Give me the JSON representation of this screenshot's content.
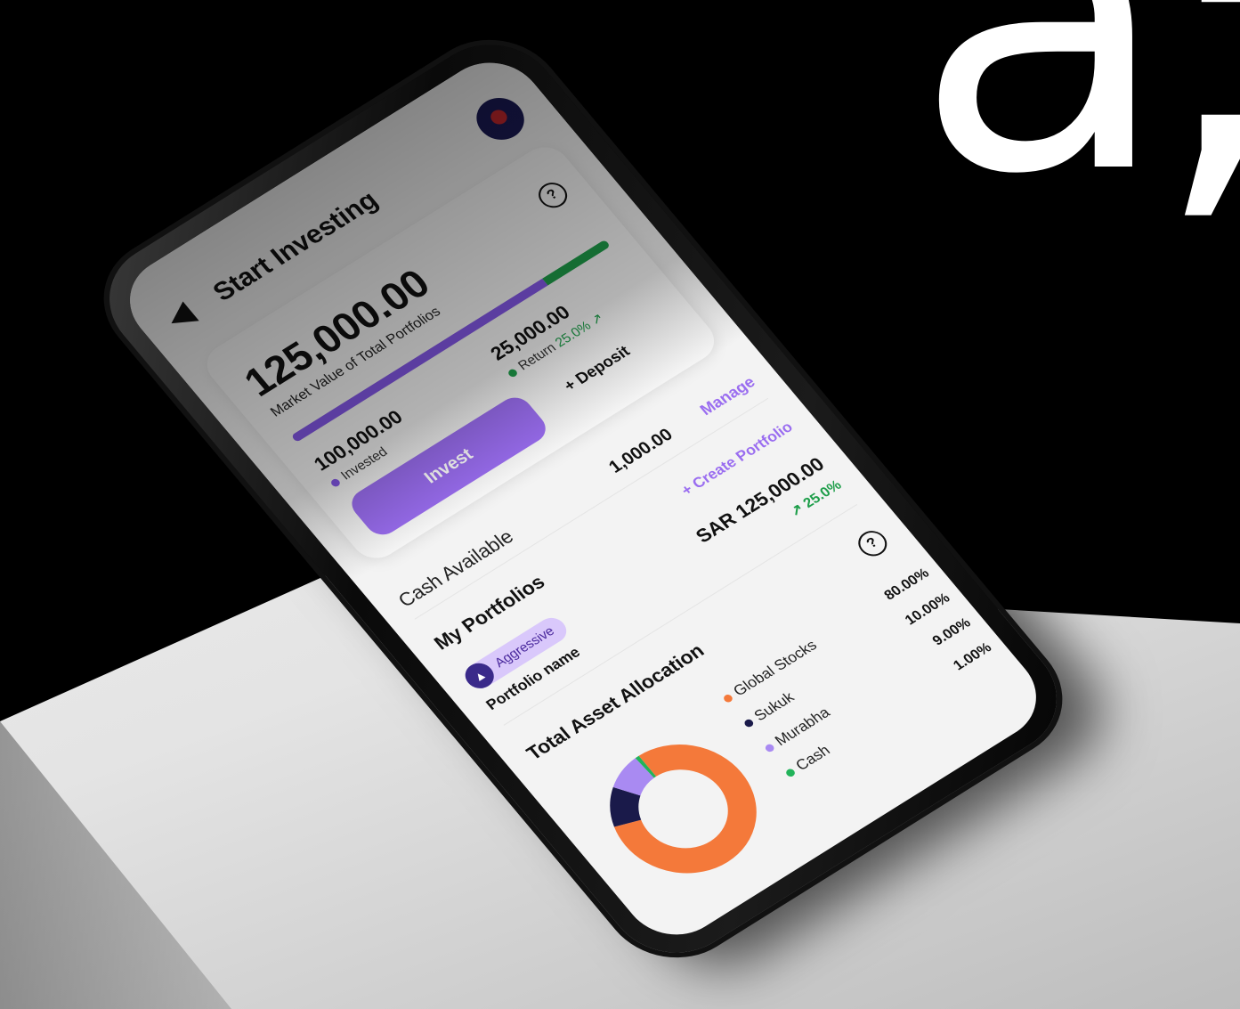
{
  "header": {
    "title": "Start Investing"
  },
  "summary": {
    "total_value": "125,000.00",
    "total_caption": "Market Value of Total Portfolios",
    "invested_value": "100,000.00",
    "invested_label": "Invested",
    "return_value": "25,000.00",
    "return_label": "Return",
    "return_pct": "25.0% ↗",
    "invested_fraction": 0.8,
    "invest_button": "Invest",
    "deposit_button": "+ Deposit"
  },
  "cash": {
    "label": "Cash Available",
    "value": "1,000.00",
    "manage_link": "Manage"
  },
  "portfolios": {
    "title": "My Portfolios",
    "create_link": "+ Create Portfolio",
    "items": [
      {
        "tag": "Aggressive",
        "name": "Portfolio name",
        "value": "SAR 125,000.00",
        "return": "↗ 25.0%"
      }
    ]
  },
  "allocation": {
    "title": "Total Asset Allocation",
    "items": [
      {
        "name": "Global Stocks",
        "percent_label": "80.00%",
        "value": 80,
        "color": "#f4793a"
      },
      {
        "name": "Sukuk",
        "percent_label": "10.00%",
        "value": 10,
        "color": "#1a1a4a"
      },
      {
        "name": "Murabha",
        "percent_label": "9.00%",
        "value": 9,
        "color": "#a98af2"
      },
      {
        "name": "Cash",
        "percent_label": "1.00%",
        "value": 1,
        "color": "#22b35a"
      }
    ]
  },
  "colors": {
    "accent": "#9a6df0",
    "invested": "#8458e8",
    "return": "#1e9e4a"
  },
  "decor": {
    "background_glyph": "a;"
  }
}
